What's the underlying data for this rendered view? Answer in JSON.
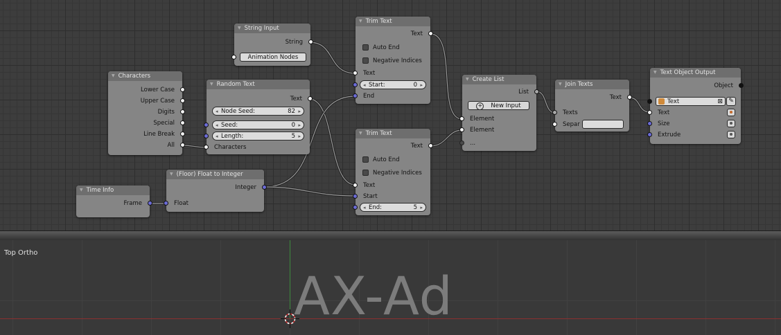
{
  "node_editor": {
    "nodes": {
      "characters": {
        "title": "Characters",
        "outputs": [
          "Lower Case",
          "Upper Case",
          "Digits",
          "Special",
          "Line Break",
          "All"
        ]
      },
      "string_input": {
        "title": "String Input",
        "output": "String",
        "value": "Animation Nodes"
      },
      "random_text": {
        "title": "Random Text",
        "output": "Text",
        "node_seed_label": "Node Seed:",
        "node_seed_value": "82",
        "seed_label": "Seed:",
        "seed_value": "0",
        "length_label": "Length:",
        "length_value": "5",
        "characters_label": "Characters"
      },
      "trim_text_1": {
        "title": "Trim Text",
        "output": "Text",
        "auto_end": "Auto End",
        "negative_indices": "Negative Indices",
        "text_input": "Text",
        "start_label": "Start:",
        "start_value": "0",
        "end_label": "End"
      },
      "trim_text_2": {
        "title": "Trim Text",
        "output": "Text",
        "auto_end": "Auto End",
        "negative_indices": "Negative Indices",
        "text_input": "Text",
        "start_label": "Start",
        "end_label": "End:",
        "end_value": "5"
      },
      "float_to_integer": {
        "title": "(Floor) Float to Integer",
        "output": "Integer",
        "input": "Float"
      },
      "time_info": {
        "title": "Time Info",
        "output": "Frame"
      },
      "create_list": {
        "title": "Create List",
        "output": "List",
        "new_input": "New Input",
        "element_1": "Element",
        "element_2": "Element",
        "more": "..."
      },
      "join_texts": {
        "title": "Join Texts",
        "output": "Text",
        "texts_input": "Texts",
        "separator_label": "Separ",
        "separator_value": ""
      },
      "text_object_output": {
        "title": "Text Object Output",
        "output": "Object",
        "object_field": "Text",
        "text_input": "Text",
        "size_input": "Size",
        "extrude_input": "Extrude"
      }
    }
  },
  "viewport": {
    "title": "Top Ortho",
    "display_text": "AX-Ad"
  },
  "colors": {
    "socket_string": "#f2f2f2",
    "socket_integer": "#6b6bd6",
    "socket_object": "#111111",
    "node_body": "#858585",
    "node_header": "#6e6e6e",
    "axis_x": "#8a3030",
    "axis_y": "#3d8a3d"
  }
}
